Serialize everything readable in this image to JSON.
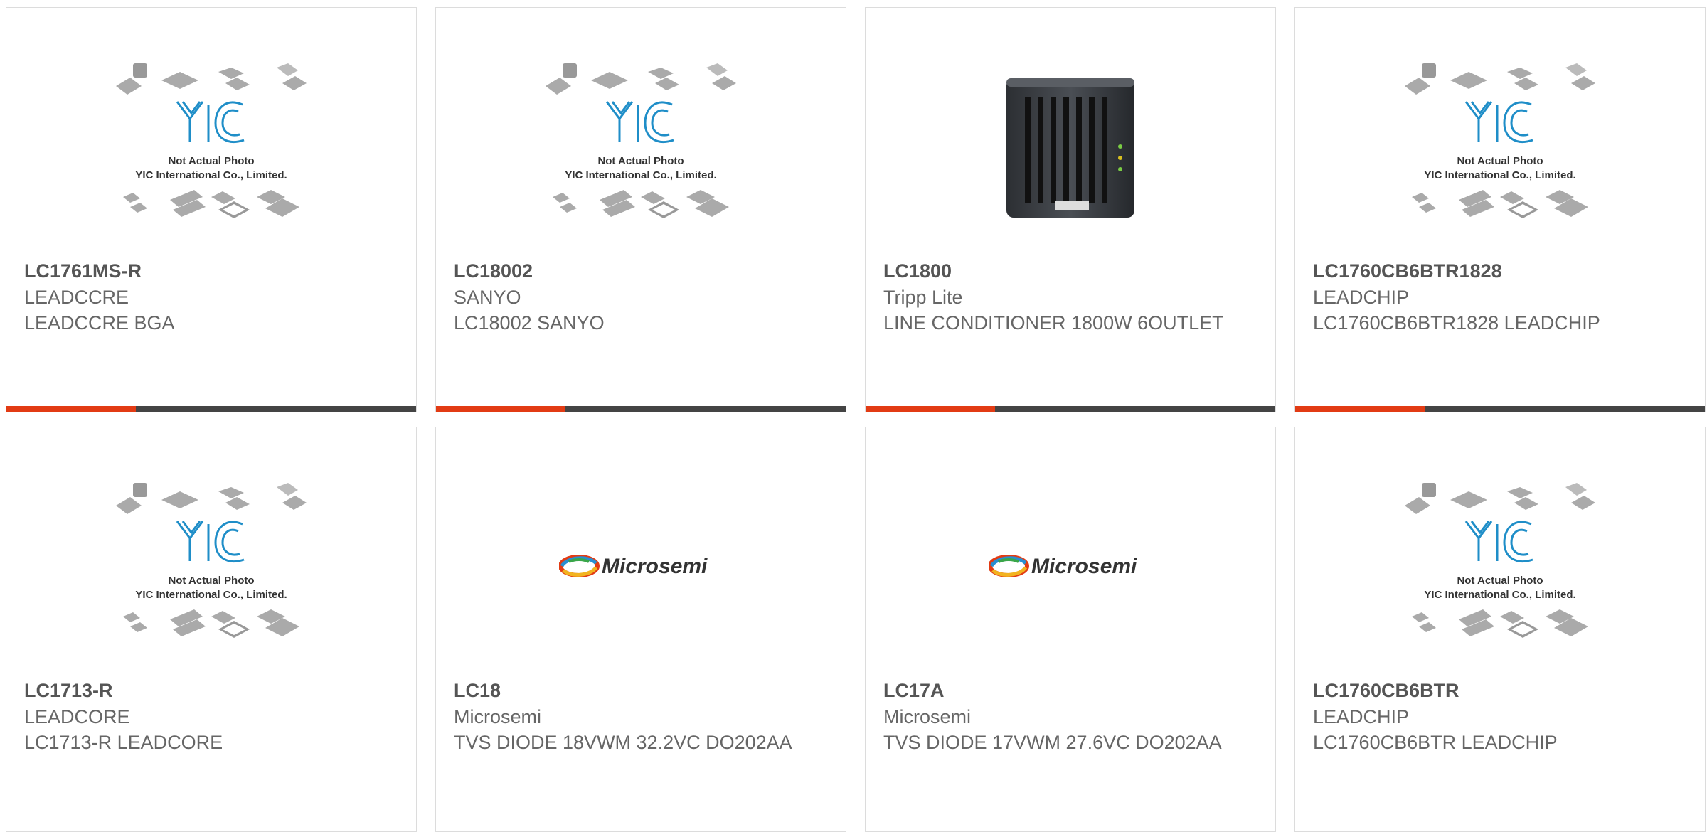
{
  "colors": {
    "accent_bar": "#e23b14",
    "dark_bar": "#444444",
    "border": "#dcdcdc",
    "yic_blue": "#1f8ec8"
  },
  "products": [
    {
      "part": "LC1761MS-R",
      "manufacturer": "LEADCCRE",
      "description": "LEADCCRE BGA",
      "image": "yic-placeholder",
      "image_text1": "Not Actual Photo",
      "image_text2": "YIC International Co., Limited."
    },
    {
      "part": "LC18002",
      "manufacturer": "SANYO",
      "description": "LC18002 SANYO",
      "image": "yic-placeholder",
      "image_text1": "Not Actual Photo",
      "image_text2": "YIC International Co., Limited."
    },
    {
      "part": "LC1800",
      "manufacturer": "Tripp Lite",
      "description": "LINE CONDITIONER 1800W 6OUTLET",
      "image": "line-conditioner"
    },
    {
      "part": "LC1760CB6BTR1828",
      "manufacturer": "LEADCHIP",
      "description": "LC1760CB6BTR1828 LEADCHIP",
      "image": "yic-placeholder",
      "image_text1": "Not Actual Photo",
      "image_text2": "YIC International Co., Limited."
    },
    {
      "part": "LC1713-R",
      "manufacturer": "LEADCORE",
      "description": "LC1713-R LEADCORE",
      "image": "yic-placeholder",
      "image_text1": "Not Actual Photo",
      "image_text2": "YIC International Co., Limited."
    },
    {
      "part": "LC18",
      "manufacturer": "Microsemi",
      "description": "TVS DIODE 18VWM 32.2VC DO202AA",
      "image": "microsemi-logo",
      "image_text1": "Microsemi"
    },
    {
      "part": "LC17A",
      "manufacturer": "Microsemi",
      "description": "TVS DIODE 17VWM 27.6VC DO202AA",
      "image": "microsemi-logo",
      "image_text1": "Microsemi"
    },
    {
      "part": "LC1760CB6BTR",
      "manufacturer": "LEADCHIP",
      "description": "LC1760CB6BTR LEADCHIP",
      "image": "yic-placeholder",
      "image_text1": "Not Actual Photo",
      "image_text2": "YIC International Co., Limited."
    }
  ]
}
